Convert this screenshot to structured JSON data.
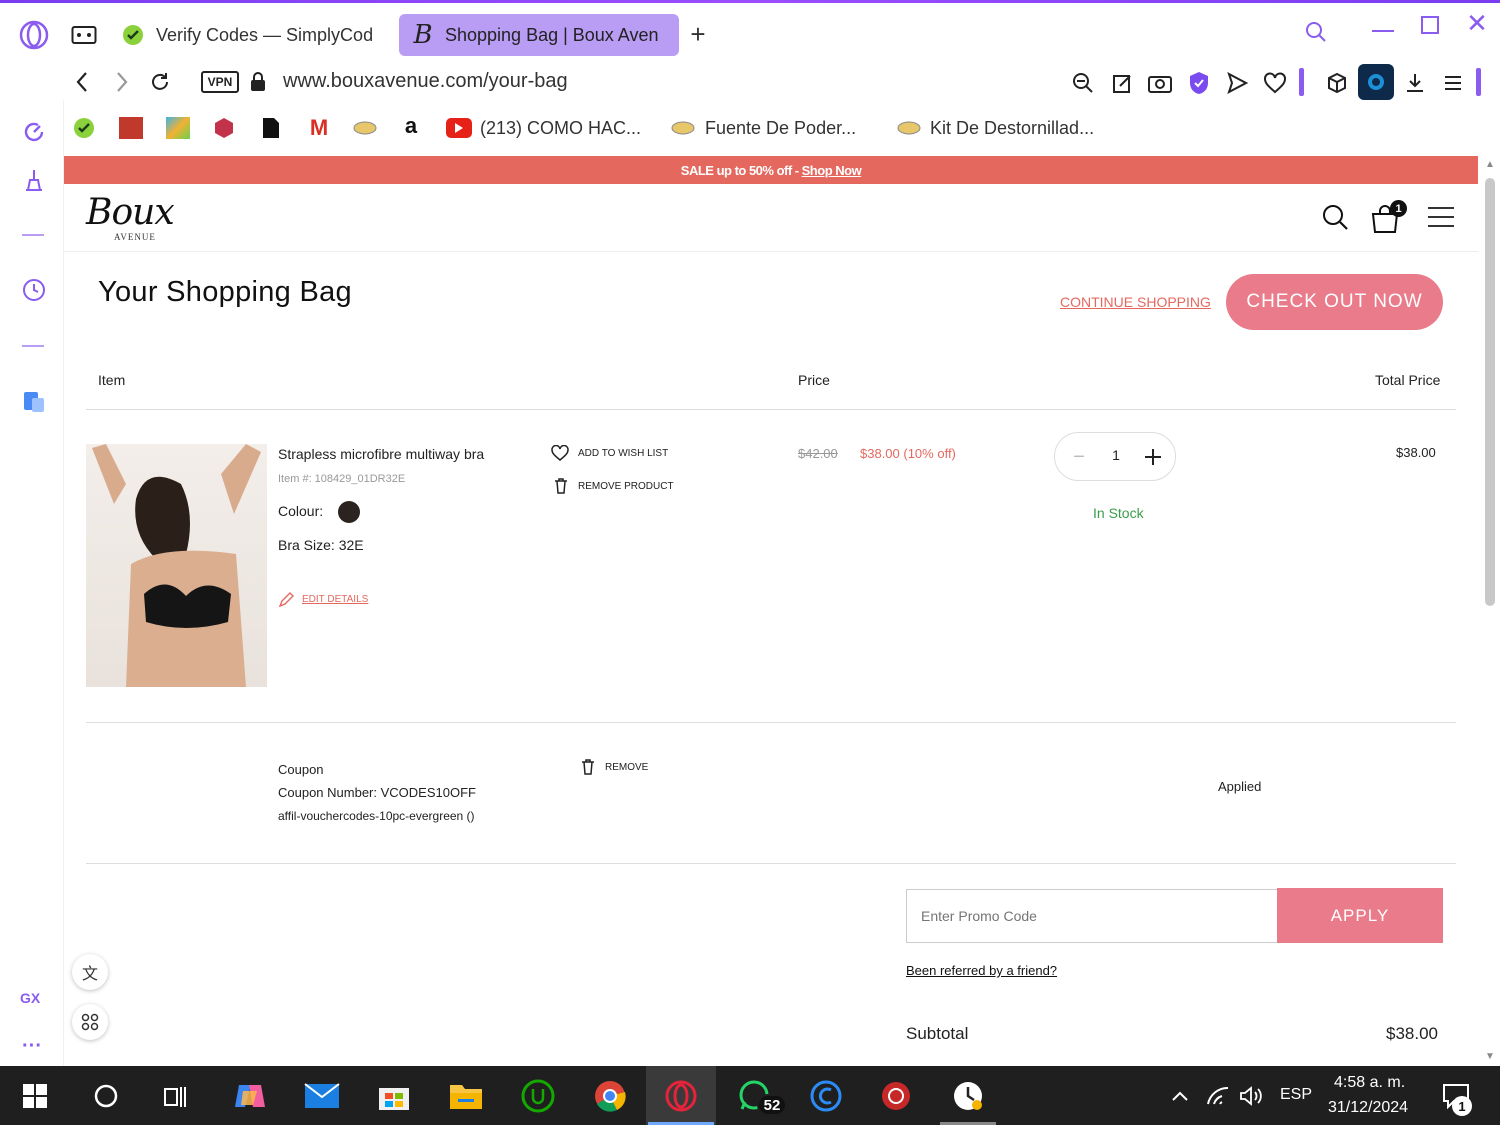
{
  "browser": {
    "tabs": [
      {
        "title": "Verify Codes — SimplyCod"
      },
      {
        "title": "Shopping Bag | Boux Aven"
      }
    ],
    "url": "www.bouxavenue.com/your-bag",
    "vpn_label": "VPN",
    "bookmarks": [
      {
        "label": "(213) COMO HAC..."
      },
      {
        "label": "Fuente De Poder..."
      },
      {
        "label": "Kit De Destornillad..."
      }
    ],
    "sidebar_gx": "GX"
  },
  "page": {
    "promo": {
      "text": "SALE up to 50% off -",
      "link": "Shop Now"
    },
    "brand": {
      "name": "Boux",
      "sub": "AVENUE"
    },
    "cart_count": "1",
    "heading": "Your Shopping Bag",
    "continue_label": "CONTINUE SHOPPING",
    "checkout_label": "CHECK OUT NOW",
    "columns": {
      "item": "Item",
      "price": "Price",
      "total": "Total Price"
    },
    "product": {
      "name": "Strapless microfibre multiway bra",
      "item_no": "Item #: 108429_01DR32E",
      "colour_label": "Colour:",
      "colour_hex": "#2b2320",
      "size": "Bra Size: 32E",
      "edit": "EDIT DETAILS",
      "wishlist": "ADD TO WISH LIST",
      "remove": "REMOVE PRODUCT",
      "old_price": "$42.00",
      "new_price": "$38.00 (10% off)",
      "qty": "1",
      "stock": "In Stock",
      "total": "$38.00"
    },
    "coupon": {
      "title": "Coupon",
      "number": "Coupon Number: VCODES10OFF",
      "detail": "affil-vouchercodes-10pc-evergreen ()",
      "remove": "REMOVE",
      "status": "Applied"
    },
    "promo_code": {
      "placeholder": "Enter Promo Code",
      "apply": "APPLY",
      "referred": "Been referred by a friend?"
    },
    "subtotal": {
      "label": "Subtotal",
      "value": "$38.00"
    }
  },
  "taskbar": {
    "whatsapp_badge": "52",
    "lang": "ESP",
    "time": "4:58 a. m.",
    "date": "31/12/2024",
    "notif": "1"
  },
  "colors": {
    "accent_pink": "#e97b8a",
    "promo_red": "#e5685f",
    "opera_purple": "#b99cf3",
    "stock_green": "#3a9d4b"
  }
}
